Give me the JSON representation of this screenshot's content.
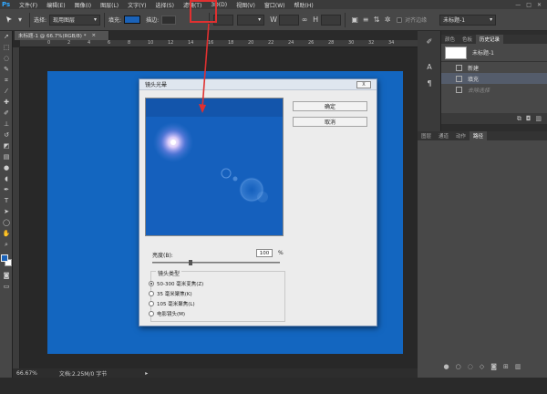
{
  "app": {
    "logo": "Ps"
  },
  "menu": [
    "文件(F)",
    "编辑(E)",
    "图像(I)",
    "图层(L)",
    "文字(Y)",
    "选择(S)",
    "滤镜(T)",
    "3D(D)",
    "视图(V)",
    "窗口(W)",
    "帮助(H)"
  ],
  "window_controls": [
    "—",
    "□",
    "✕"
  ],
  "options": {
    "select_label": "选择:",
    "select_value": "现用图层",
    "fill_label": "填充:",
    "stroke_label": "描边:",
    "align_edges": "对齐边缘",
    "workspace_value": "未标题-1"
  },
  "document": {
    "tab_title": "未标题-1 @ 66.7%(RGB/8) *",
    "zoom": "66.67%",
    "doc_info": "文档:2.25M/0 字节",
    "ruler_marks": [
      "0",
      "2",
      "4",
      "6",
      "8",
      "10",
      "12",
      "14",
      "16",
      "18",
      "20",
      "22",
      "24",
      "26",
      "28",
      "30",
      "32",
      "34"
    ]
  },
  "colors": {
    "canvas": "#1366c0",
    "foreground": "#1a62b8",
    "background": "#ffffff",
    "annotation": "#e03030"
  },
  "dialog": {
    "title": "镜头光晕",
    "close": "X",
    "ok": "确定",
    "cancel": "取消",
    "brightness_label": "亮度(B):",
    "brightness_value": "100",
    "brightness_unit": "%",
    "lens_type_label": "镜头类型",
    "lens_options": [
      {
        "label": "50-300 毫米变焦(Z)",
        "selected": true
      },
      {
        "label": "35 毫米聚焦(K)",
        "selected": false
      },
      {
        "label": "105 毫米聚焦(L)",
        "selected": false
      },
      {
        "label": "电影镜头(M)",
        "selected": false
      }
    ]
  },
  "history_panel": {
    "tabs": [
      "颜色",
      "色板",
      "历史记录"
    ],
    "snapshot": "未标题-1",
    "items": [
      {
        "label": "新建",
        "state": "normal"
      },
      {
        "label": "填充",
        "state": "selected"
      },
      {
        "label": "去除选择",
        "state": "ghost"
      }
    ]
  },
  "layers_panel": {
    "tabs": [
      "图层",
      "通道",
      "动作",
      "路径"
    ]
  },
  "tools": [
    "move-tool",
    "marquee-tool",
    "lasso-tool",
    "quick-select-tool",
    "crop-tool",
    "eyedropper-tool",
    "healing-tool",
    "brush-tool",
    "stamp-tool",
    "history-brush-tool",
    "eraser-tool",
    "gradient-tool",
    "blur-tool",
    "dodge-tool",
    "pen-tool",
    "type-tool",
    "path-select-tool",
    "shape-tool",
    "hand-tool",
    "zoom-tool"
  ]
}
